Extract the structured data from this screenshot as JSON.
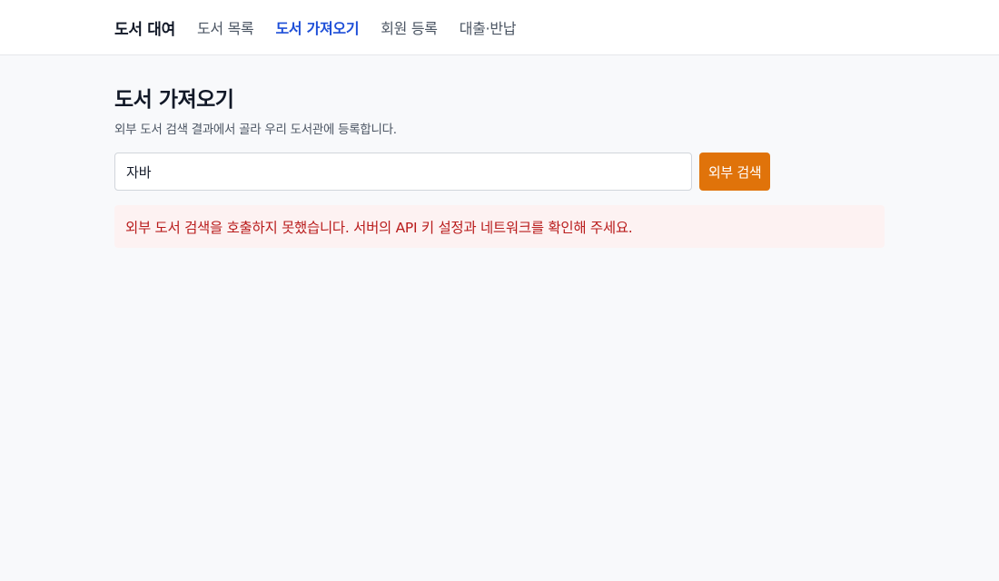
{
  "nav": {
    "brand": "도서 대여",
    "items": [
      {
        "label": "도서 목록",
        "active": false
      },
      {
        "label": "도서 가져오기",
        "active": true
      },
      {
        "label": "회원 등록",
        "active": false
      },
      {
        "label": "대출·반납",
        "active": false
      }
    ]
  },
  "page": {
    "title": "도서 가져오기",
    "description": "외부 도서 검색 결과에서 골라 우리 도서관에 등록합니다."
  },
  "search": {
    "value": "자바",
    "button_label": "외부 검색"
  },
  "error": {
    "message": "외부 도서 검색을 호출하지 못했습니다. 서버의 API 키 설정과 네트워크를 확인해 주세요."
  },
  "colors": {
    "accent": "#1d4ed8",
    "button": "#e0730a",
    "error_text": "#b91c1c",
    "error_bg": "#fdf2f2"
  }
}
